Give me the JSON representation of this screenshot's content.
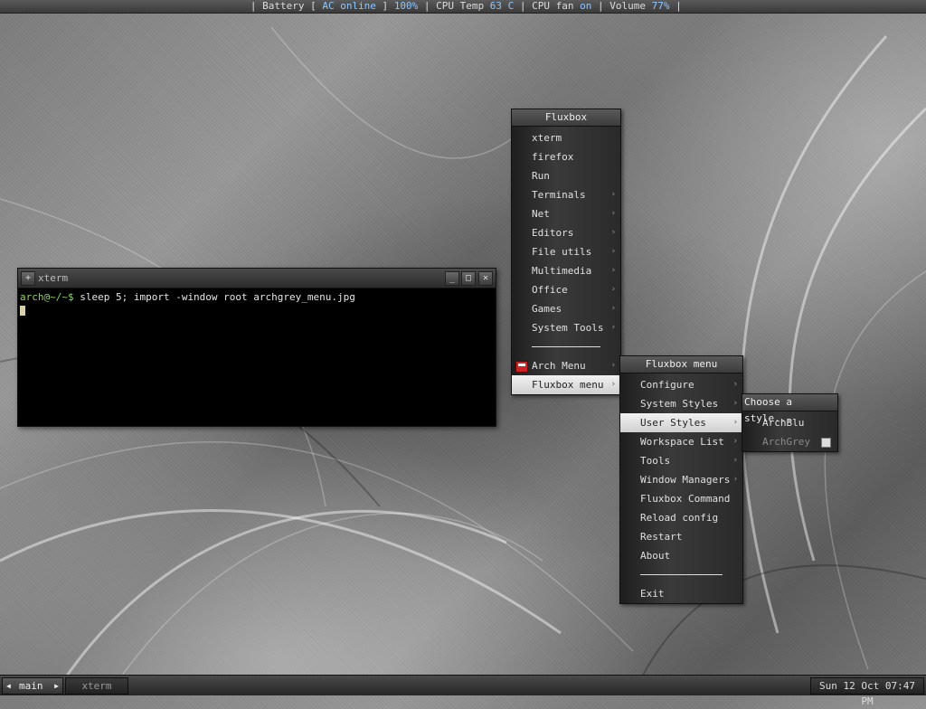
{
  "statusbar": {
    "p1": " | Battery [ ",
    "ac": "AC online",
    "p2": " ] ",
    "battery_pct": "100%",
    "p3": " | CPU Temp ",
    "temp": "63 C",
    "p4": " | CPU fan ",
    "fan": "on",
    "p5": " | Volume ",
    "volume": "77%",
    "p6": " |"
  },
  "main_menu": {
    "title": "Fluxbox",
    "items": [
      {
        "label": "xterm"
      },
      {
        "label": "firefox"
      },
      {
        "label": "Run"
      },
      {
        "label": "Terminals"
      },
      {
        "label": "Net"
      },
      {
        "label": "Editors"
      },
      {
        "label": "File utils"
      },
      {
        "label": "Multimedia"
      },
      {
        "label": "Office"
      },
      {
        "label": "Games"
      },
      {
        "label": "System Tools"
      }
    ],
    "arch_menu": "Arch Menu",
    "fluxbox_menu": "Fluxbox menu"
  },
  "fluxbox_submenu": {
    "title": "Fluxbox menu",
    "items": [
      {
        "label": "Configure"
      },
      {
        "label": "System Styles"
      },
      {
        "label": "User Styles"
      },
      {
        "label": "Workspace List"
      },
      {
        "label": "Tools"
      },
      {
        "label": "Window Managers"
      },
      {
        "label": "Fluxbox Command"
      },
      {
        "label": "Reload config"
      },
      {
        "label": "Restart"
      },
      {
        "label": "About"
      }
    ],
    "exit": "Exit"
  },
  "styles_submenu": {
    "title": "Choose a style...",
    "items": [
      {
        "label": "ArchBlu"
      },
      {
        "label": "ArchGrey"
      }
    ]
  },
  "xterm": {
    "title": "xterm",
    "prompt": "arch@~/~$",
    "command": " sleep 5; import -window root archgrey_menu.jpg"
  },
  "taskbar": {
    "workspace": "main",
    "task": "xterm",
    "clock": "Sun 12 Oct 07:47 PM"
  },
  "colors": {
    "highlight": "#8fc7ff",
    "prompt": "#8fd16b",
    "active_item_bg": "#e6e6e6"
  }
}
